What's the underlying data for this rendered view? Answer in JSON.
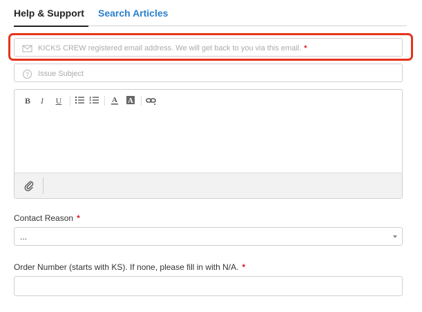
{
  "tabs": [
    {
      "label": "Help & Support",
      "active": true
    },
    {
      "label": "Search Articles",
      "active": false
    }
  ],
  "email_field": {
    "placeholder": "KICKS CREW registered email address. We will get back to you via this email.",
    "required_mark": "*",
    "icon": "envelope-icon"
  },
  "subject_field": {
    "placeholder": "Issue Subject",
    "icon": "question-circle-icon"
  },
  "editor": {
    "toolbar": {
      "bold": "B",
      "italic": "I",
      "underline": "U",
      "icons": [
        "bulleted-list-icon",
        "numbered-list-icon",
        "text-color-icon",
        "highlight-color-icon",
        "link-icon"
      ]
    },
    "footer_icon": "paperclip-icon"
  },
  "contact_reason": {
    "label": "Contact Reason",
    "required_mark": "*",
    "selected": "..."
  },
  "order_number": {
    "label": "Order Number (starts with KS). If none, please fill in with N/A.",
    "required_mark": "*",
    "value": ""
  },
  "colors": {
    "accent_blue": "#2a7fcc",
    "required_red": "#d21a1a",
    "highlight_red": "#e5331c"
  }
}
